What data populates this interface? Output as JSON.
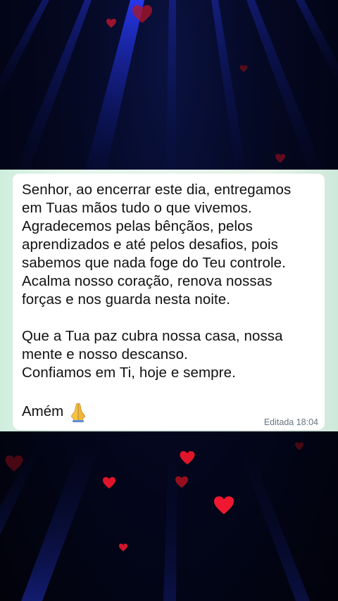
{
  "message": {
    "lines": [
      "Senhor, ao encerrar este dia, entregamos",
      "em Tuas mãos tudo o que vivemos.",
      "Agradecemos pelas bênçãos, pelos",
      "aprendizados e até pelos desafios, pois",
      "sabemos que nada foge do Teu controle.",
      "Acalma nosso coração, renova nossas",
      "forças e nos guarda nesta noite.",
      "",
      "Que a Tua paz cubra nossa casa, nossa",
      "mente e nosso descanso.",
      "Confiamos em Ti, hoje e sempre."
    ],
    "closing": "Amém",
    "closing_icon": "praying-hands-icon",
    "edited_label": "Editada",
    "time": "18:04"
  },
  "colors": {
    "bubble": "#ffffff",
    "band": "#e3f3e9",
    "background": "#02040f",
    "heart": "#e0152a",
    "beam": "#1b2fd6"
  }
}
